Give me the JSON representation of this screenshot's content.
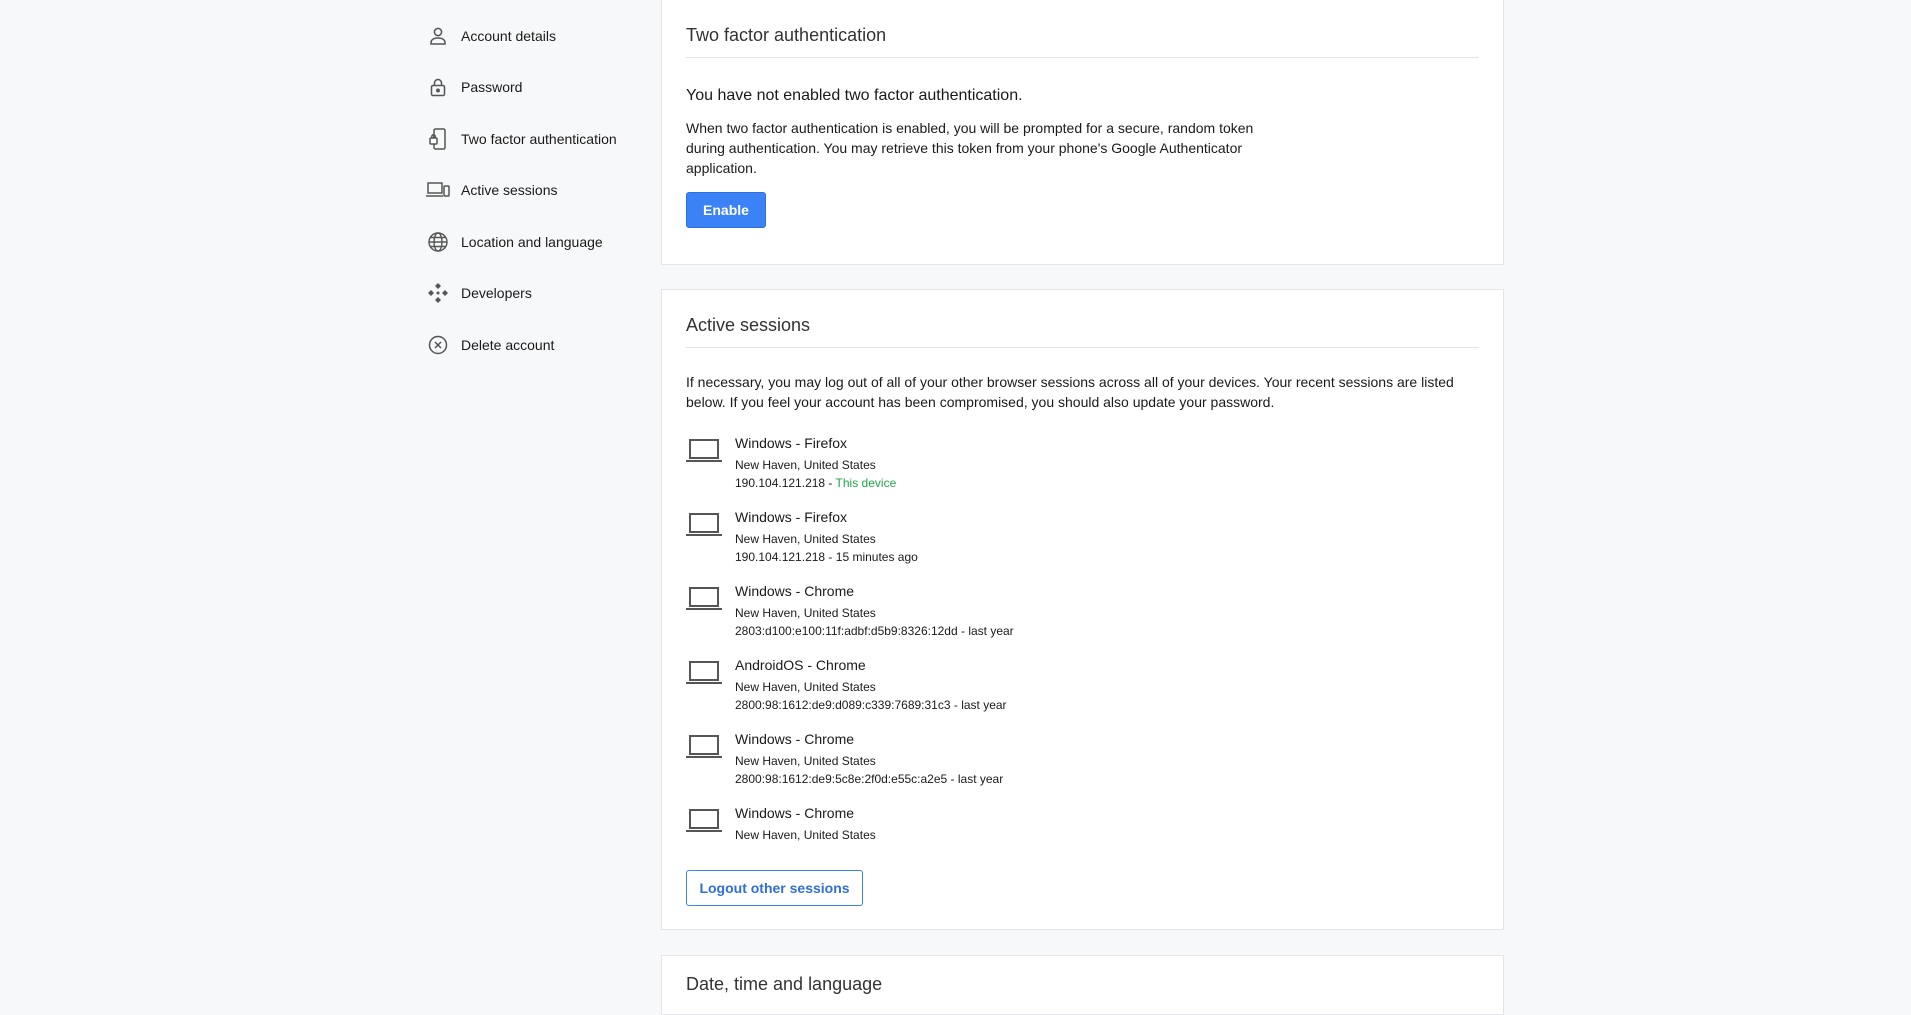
{
  "sidebar": {
    "items": [
      {
        "label": "Account details",
        "icon": "person-icon"
      },
      {
        "label": "Password",
        "icon": "lock-icon"
      },
      {
        "label": "Two factor authentication",
        "icon": "phone-lock-icon"
      },
      {
        "label": "Active sessions",
        "icon": "devices-icon"
      },
      {
        "label": "Location and language",
        "icon": "globe-icon"
      },
      {
        "label": "Developers",
        "icon": "developers-icon"
      },
      {
        "label": "Delete account",
        "icon": "close-circle-icon"
      }
    ]
  },
  "two_factor": {
    "title": "Two factor authentication",
    "status": "You have not enabled two factor authentication.",
    "description": "When two factor authentication is enabled, you will be prompted for a secure, random token during authentication. You may retrieve this token from your phone's Google Authenticator application.",
    "enable_label": "Enable"
  },
  "active_sessions": {
    "title": "Active sessions",
    "description": "If necessary, you may log out of all of your other browser sessions across all of your devices. Your recent sessions are listed below. If you feel your account has been compromised, you should also update your password.",
    "sessions": [
      {
        "name": "Windows - Firefox",
        "location": "New Haven, United States",
        "ip": "190.104.121.218",
        "separator": " - ",
        "status": "This device"
      },
      {
        "name": "Windows - Firefox",
        "location": "New Haven, United States",
        "ip": "190.104.121.218",
        "separator": " - ",
        "status": "15 minutes ago"
      },
      {
        "name": "Windows - Chrome",
        "location": "New Haven, United States",
        "ip": "2803:d100:e100:11f:adbf:d5b9:8326:12dd",
        "separator": " - ",
        "status": "last year"
      },
      {
        "name": "AndroidOS - Chrome",
        "location": "New Haven, United States",
        "ip": "2800:98:1612:de9:d089:c339:7689:31c3",
        "separator": " - ",
        "status": "last year"
      },
      {
        "name": "Windows - Chrome",
        "location": "New Haven, United States",
        "ip": "2800:98:1612:de9:5c8e:2f0d:e55c:a2e5",
        "separator": " - ",
        "status": "last year"
      },
      {
        "name": "Windows - Chrome",
        "location": "New Haven, United States",
        "ip": "",
        "separator": "",
        "status": ""
      }
    ],
    "logout_label": "Logout other sessions"
  },
  "datetime": {
    "title": "Date, time and language"
  },
  "colors": {
    "primary": "#3b82f6",
    "this_device": "#22a34a",
    "background": "#f7f8fa"
  }
}
